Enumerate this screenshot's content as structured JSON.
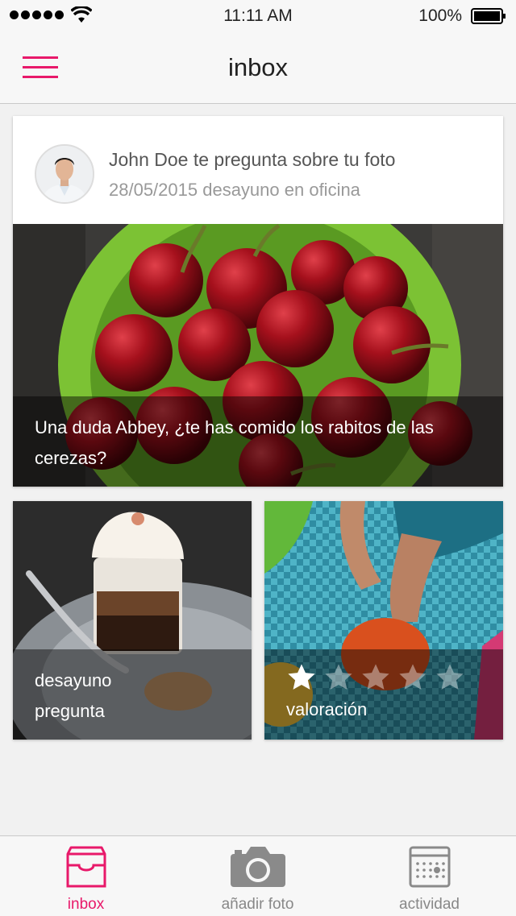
{
  "status_bar": {
    "time": "11:11 AM",
    "battery": "100%"
  },
  "nav": {
    "title": "inbox",
    "menu_icon": "hamburger-menu-icon",
    "accent": "#e8196a"
  },
  "message": {
    "title": "John Doe te pregunta sobre tu foto",
    "subtitle": "28/05/2015 desayuno en oficina",
    "question_line1": "Una duda Abbey, ¿te has comido los rabitos de las",
    "question_line2": "cerezas?"
  },
  "cards": [
    {
      "line1": "desayuno",
      "line2": "pregunta"
    },
    {
      "label": "valoración",
      "rating": 1,
      "max_rating": 5
    }
  ],
  "tabs": [
    {
      "label": "inbox",
      "icon": "inbox-tray-icon",
      "active": true
    },
    {
      "label": "añadir foto",
      "icon": "camera-icon",
      "active": false
    },
    {
      "label": "actividad",
      "icon": "calendar-icon",
      "active": false
    }
  ]
}
